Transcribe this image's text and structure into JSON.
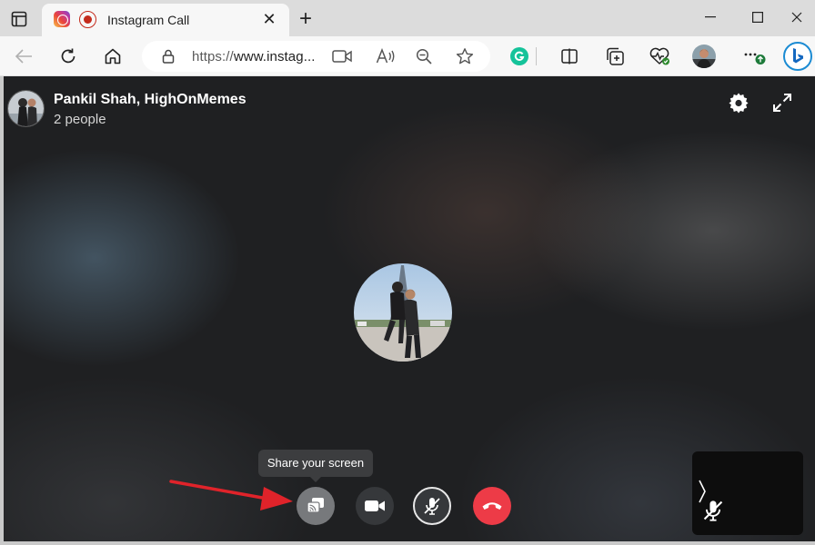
{
  "browser": {
    "tab": {
      "title": "Instagram Call",
      "favicon": "instagram-icon",
      "recording_indicator": "record-icon"
    },
    "address_bar": {
      "url_protocol": "https://",
      "url_rest": "www.instag..."
    },
    "toolbar_icons": [
      "back-icon",
      "refresh-icon",
      "home-icon",
      "lock-icon",
      "camera-icon",
      "read-aloud-icon",
      "zoom-out-icon",
      "favorite-star-icon",
      "grammarly-icon",
      "split-screen-icon",
      "collections-icon",
      "browser-essentials-icon",
      "profile-avatar",
      "more-icon",
      "bing-icon"
    ],
    "accent_color": "#0f6cbd"
  },
  "call": {
    "participants": "Pankil Shah, HighOnMemes",
    "people_count": "2 people",
    "tooltip": "Share your screen",
    "controls": [
      "share-screen-button",
      "video-button",
      "mic-button",
      "end-call-button"
    ],
    "end_call_color": "#ed3b47"
  }
}
